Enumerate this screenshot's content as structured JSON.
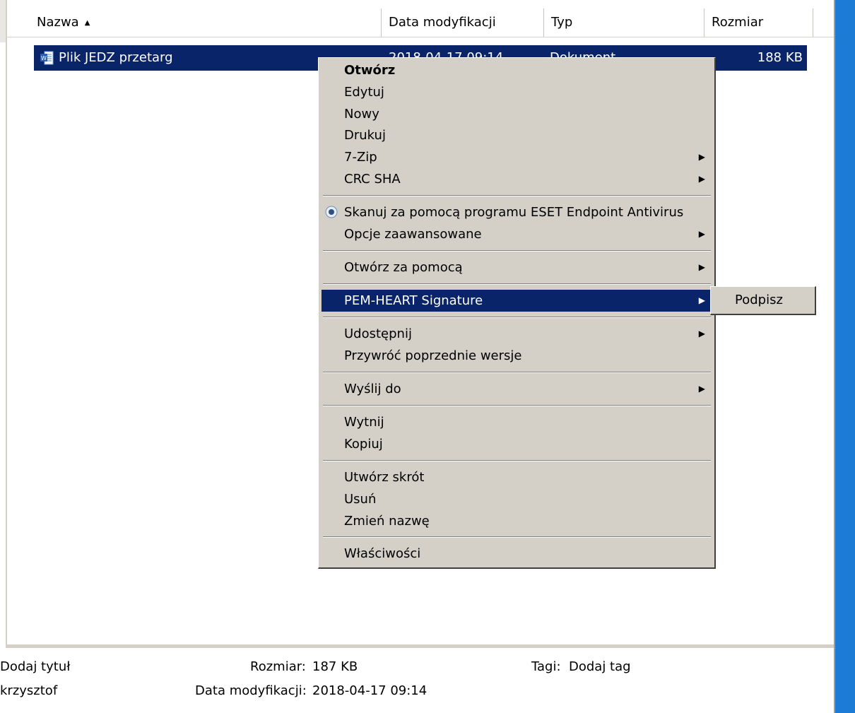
{
  "header": {
    "name": "Nazwa",
    "date_modified": "Data modyfikacji",
    "type": "Typ",
    "size": "Rozmiar"
  },
  "file": {
    "name": "Plik JEDZ przetarg",
    "date": "2018-04-17 09:14",
    "type": "Dokument",
    "size": "188 KB"
  },
  "context_menu": {
    "open": "Otwórz",
    "edit": "Edytuj",
    "new": "Nowy",
    "print": "Drukuj",
    "zip": "7-Zip",
    "crc": "CRC SHA",
    "eset_scan": "Skanuj za pomocą programu ESET Endpoint Antivirus",
    "advanced": "Opcje zaawansowane",
    "open_with": "Otwórz za pomocą",
    "pem": "PEM-HEART Signature",
    "share": "Udostępnij",
    "restore": "Przywróć poprzednie wersje",
    "send_to": "Wyślij do",
    "cut": "Wytnij",
    "copy": "Kopiuj",
    "shortcut": "Utwórz skrót",
    "delete": "Usuń",
    "rename": "Zmień nazwę",
    "properties": "Właściwości"
  },
  "submenu": {
    "sign": "Podpisz"
  },
  "details": {
    "title": "Dodaj tytuł",
    "author": "krzysztof",
    "size_label": "Rozmiar:",
    "size_value": "187 KB",
    "date_label": "Data modyfikacji:",
    "date_value": "2018-04-17 09:14",
    "tags_label": "Tagi:",
    "tags_value": "Dodaj tag"
  },
  "colors": {
    "selection": "#0a246a",
    "menu_bg": "#d4d0c8",
    "side_bar": "#1c7bd4"
  }
}
